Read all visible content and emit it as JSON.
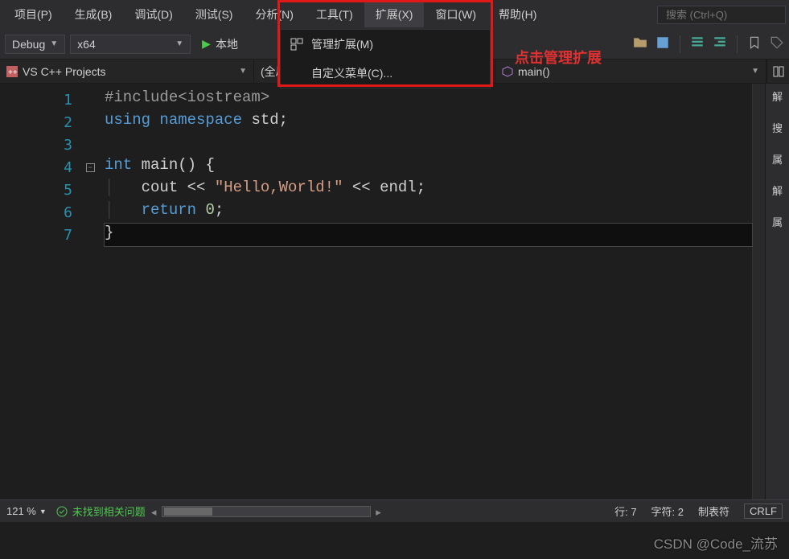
{
  "menubar": {
    "items": [
      "项目(P)",
      "生成(B)",
      "调试(D)",
      "测试(S)",
      "分析(N)",
      "工具(T)",
      "扩展(X)",
      "窗口(W)",
      "帮助(H)"
    ],
    "active_index": 6,
    "search_placeholder": "搜索 (Ctrl+Q)"
  },
  "dropdown": {
    "items": [
      {
        "icon": "extension-icon",
        "label": "管理扩展(M)"
      },
      {
        "icon": "",
        "label": "自定义菜单(C)..."
      }
    ]
  },
  "annotation_text": "点击管理扩展",
  "toolbar": {
    "config": "Debug",
    "platform": "x64",
    "run_label": "本地"
  },
  "navbar": {
    "project": "VS C++ Projects",
    "scope": "(全局范围)",
    "function": "main()"
  },
  "code": {
    "lines": [
      {
        "n": 1,
        "html": "<span class='pp'>#include</span><span class='pp'>&lt;iostream&gt;</span>"
      },
      {
        "n": 2,
        "html": "<span class='kw'>using</span> <span class='kw'>namespace</span> <span class='ident'>std</span>;"
      },
      {
        "n": 3,
        "html": ""
      },
      {
        "n": 4,
        "html": "<span class='kw'>int</span> <span class='ident'>main</span>() {",
        "fold": true
      },
      {
        "n": 5,
        "html": "<span class='guide'>│</span>   <span class='ident'>cout</span> &lt;&lt; <span class='str'>\"Hello,World!\"</span> &lt;&lt; <span class='ident'>endl</span>;"
      },
      {
        "n": 6,
        "html": "<span class='guide'>│</span>   <span class='kw'>return</span> <span class='num'>0</span>;"
      },
      {
        "n": 7,
        "html": "}",
        "current": true
      }
    ]
  },
  "right_panel": {
    "labels": [
      "解",
      "搜",
      "属",
      "解",
      "属"
    ]
  },
  "statusbar": {
    "zoom": "121 %",
    "issues": "未找到相关问题",
    "line_label": "行:",
    "line": "7",
    "col_label": "字符:",
    "col": "2",
    "tabs": "制表符",
    "eol": "CRLF"
  },
  "watermark": "CSDN @Code_流苏"
}
